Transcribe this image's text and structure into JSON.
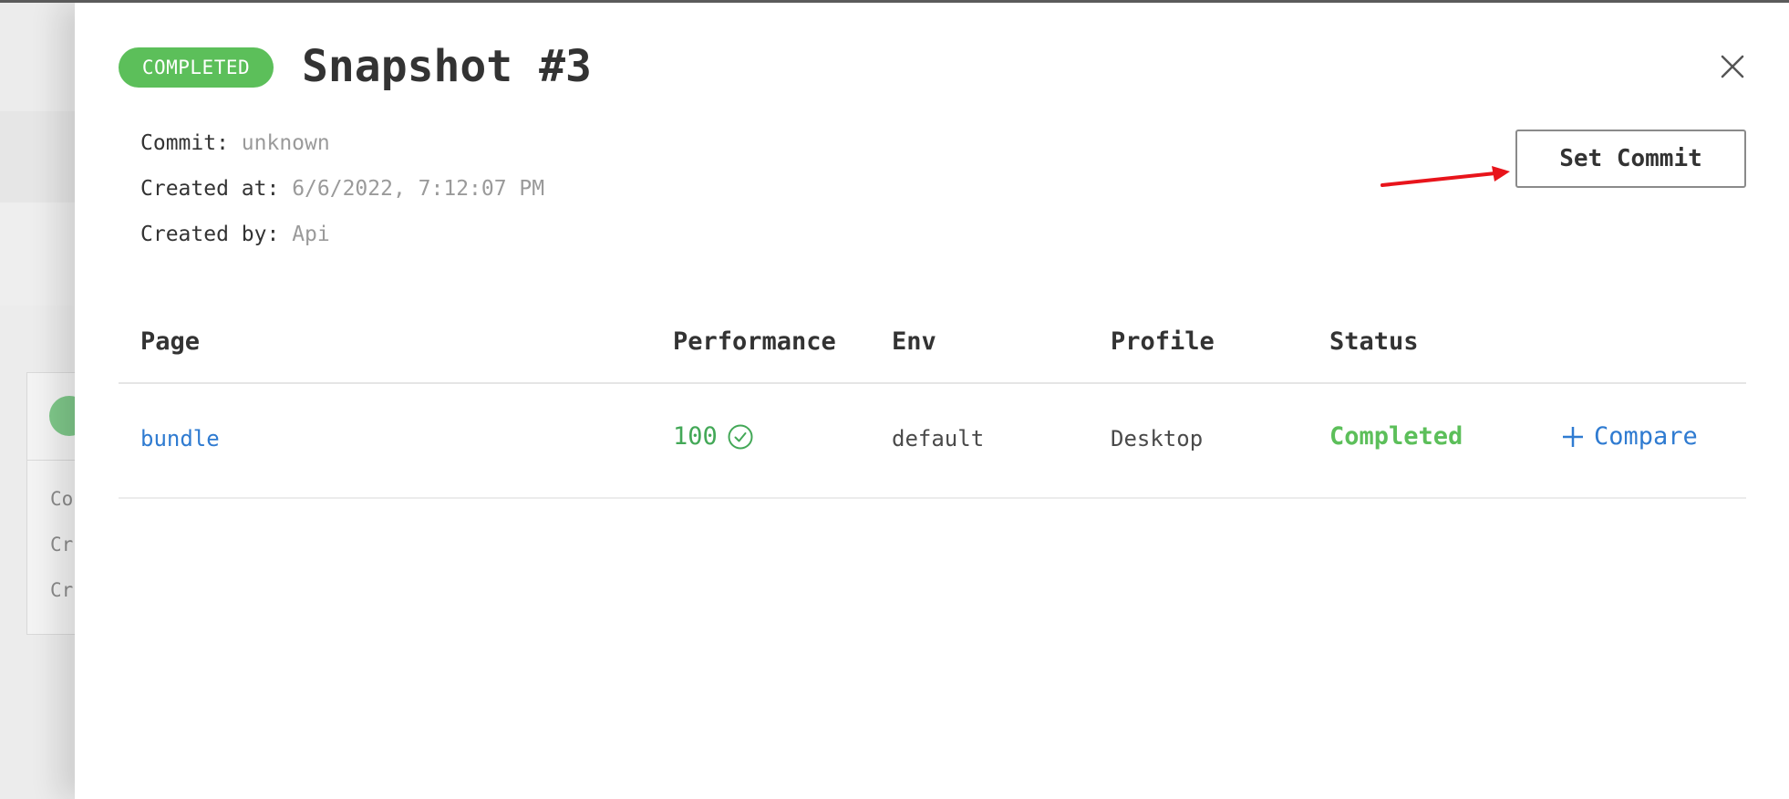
{
  "drawer": {
    "status_badge": "COMPLETED",
    "title": "Snapshot #3"
  },
  "meta": {
    "commit_label": "Commit:",
    "commit_value": "unknown",
    "created_at_label": "Created at:",
    "created_at_value": "6/6/2022, 7:12:07 PM",
    "created_by_label": "Created by:",
    "created_by_value": "Api"
  },
  "actions": {
    "set_commit_label": "Set Commit"
  },
  "table": {
    "headers": [
      "Page",
      "Performance",
      "Env",
      "Profile",
      "Status"
    ],
    "rows": [
      {
        "page": "bundle",
        "performance": "100",
        "env": "default",
        "profile": "Desktop",
        "status": "Completed",
        "compare_label": "Compare"
      }
    ]
  },
  "background": {
    "lines": [
      "Co",
      "Cr",
      "Cr"
    ]
  },
  "colors": {
    "success": "#5cbf5a",
    "link": "#2f7bd1",
    "annotation_arrow": "#e8141b"
  },
  "icons": {
    "close": "close-icon",
    "performance_check": "check-circle-icon",
    "compare_plus": "plus-icon",
    "background_check": "check-icon"
  }
}
